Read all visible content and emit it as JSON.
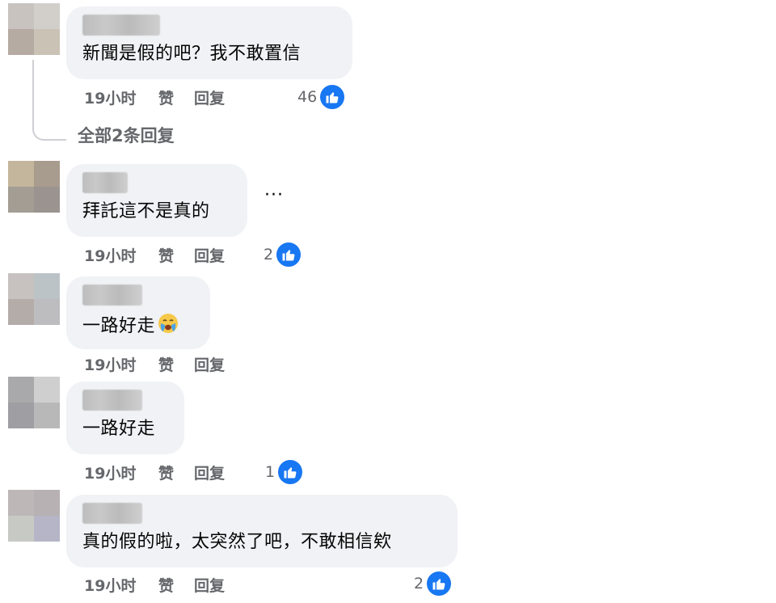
{
  "comments": [
    {
      "text": "新聞是假的吧？我不敢置信",
      "time": "19小时",
      "like_label": "赞",
      "reply_label": "回复",
      "reaction_count": "46",
      "view_replies": "全部2条回复",
      "avatar_colors": [
        "#c8c3bf",
        "#d2cfcb",
        "#b6aba3",
        "#c9c2b5"
      ]
    },
    {
      "text": "拜託這不是真的",
      "time": "19小时",
      "like_label": "赞",
      "reply_label": "回复",
      "reaction_count": "2",
      "more_icon": "ellipsis-icon",
      "avatar_colors": [
        "#c4b69c",
        "#a89c8e",
        "#a39d94",
        "#9b938f"
      ]
    },
    {
      "text": "一路好走",
      "emoji": "crying-face-emoji",
      "time": "19小时",
      "like_label": "赞",
      "reply_label": "回复",
      "avatar_colors": [
        "#c7c2c0",
        "#bcc3c7",
        "#b4aca9",
        "#bdbdc0"
      ]
    },
    {
      "text": "一路好走",
      "time": "19小时",
      "like_label": "赞",
      "reply_label": "回复",
      "reaction_count": "1",
      "avatar_colors": [
        "#a9a9ab",
        "#cfcfcf",
        "#9e9ea3",
        "#b8b8b8"
      ]
    },
    {
      "text": "真的假的啦，太突然了吧，不敢相信欸",
      "time": "19小时",
      "like_label": "赞",
      "reply_label": "回复",
      "reaction_count": "2",
      "avatar_colors": [
        "#bdb7b8",
        "#b8b1b3",
        "#c7c9c4",
        "#b5b5c7"
      ]
    }
  ],
  "colors": {
    "bubble": "#f0f2f5",
    "secondary_text": "#65676b",
    "like_blue": "#1877f2"
  }
}
